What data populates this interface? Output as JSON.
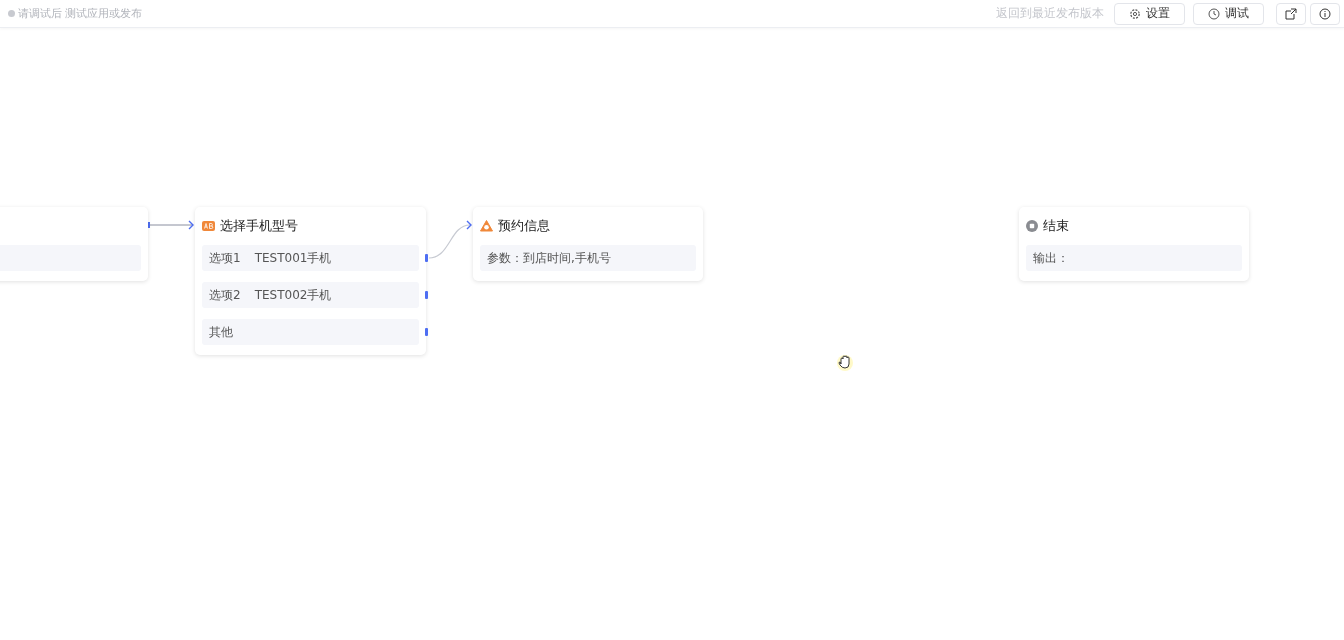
{
  "header": {
    "notice": "请调试后 测试应用或发布",
    "revert_link": "返回到最近发布版本",
    "buttons": [
      {
        "label": "设置",
        "kind": "settings"
      },
      {
        "label": "调试",
        "kind": "debug"
      }
    ]
  },
  "nodes": [
    {
      "kind": "partial",
      "rows": [
        {
          "kind": "blank"
        }
      ]
    },
    {
      "kind": "choice",
      "title": "选择手机型号",
      "rows": [
        {
          "kind": "option",
          "label": "选项1",
          "value": "TEST001手机"
        },
        {
          "kind": "option",
          "label": "选项2",
          "value": "TEST002手机"
        },
        {
          "kind": "option",
          "label": "其他"
        }
      ]
    },
    {
      "kind": "info",
      "title": "预约信息",
      "rows": [
        {
          "kind": "text",
          "label": "参数：到店时间,手机号"
        }
      ]
    },
    {
      "kind": "end",
      "title": "结束",
      "rows": [
        {
          "kind": "text",
          "label": "输出："
        }
      ]
    }
  ]
}
